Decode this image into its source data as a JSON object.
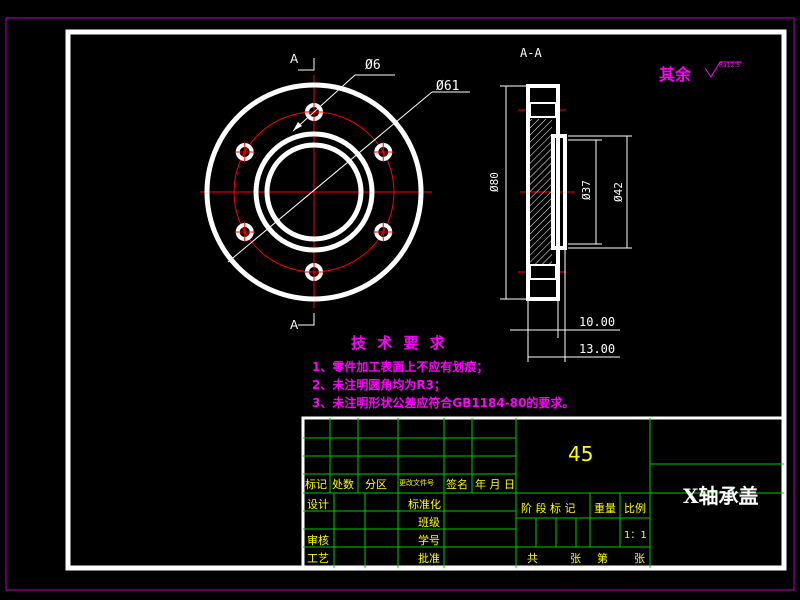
{
  "colors": {
    "background": "#000000",
    "border_outer": "#c000c0",
    "frame": "#ffffff",
    "centerline": "#ff0000",
    "dimension": "#ffffff",
    "note_text": "#ff00ff",
    "title_grid": "#00cc00",
    "title_text": "#ffff00",
    "part_name_text": "#ffffff"
  },
  "views": {
    "section_mark_top": "A",
    "section_mark_bottom": "A",
    "section_title": "A-A"
  },
  "dimensions": {
    "hole_dia": "Ø6",
    "bolt_circle": "Ø61",
    "outer_dia": "Ø80",
    "inner_dia": "Ø37",
    "boss_dia": "Ø42",
    "thickness_flange": "10.00",
    "thickness_total": "13.00"
  },
  "surface_finish": {
    "label": "其余",
    "value": "Ra12.5"
  },
  "technical_requirements": {
    "heading": "技 术 要 求",
    "items": [
      "1、零件加工表面上不应有划痕；",
      "2、未注明圆角均为R3；",
      "3、未注明形状公差应符合GB1184-80的要求。"
    ]
  },
  "title_block": {
    "material": "45",
    "part_name": "X轴承盖",
    "revision_headers": [
      "标记",
      "处数",
      "分区",
      "更改文件号",
      "签名",
      "年 月 日"
    ],
    "left_labels": {
      "design": "设计",
      "standardize": "标准化",
      "check": "审核",
      "process": "工艺",
      "approve": "批准",
      "proofread": "班级",
      "student_no": "学号"
    },
    "stage_headers": {
      "stage_mark": "阶 段 标 记",
      "weight": "重量",
      "scale": "比例"
    },
    "scale_value": "1：1",
    "sheets": {
      "total": "共",
      "sheet_unit": "张",
      "number": "第",
      "sheet_unit2": "张"
    }
  }
}
